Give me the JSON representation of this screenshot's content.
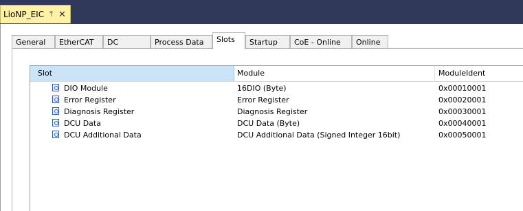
{
  "document_tab": {
    "title": "LioNP_EIC",
    "pin_icon": "pin-icon",
    "close_icon": "close-icon"
  },
  "tabs": [
    {
      "label": "General",
      "active": false
    },
    {
      "label": "EtherCAT",
      "active": false
    },
    {
      "label": "DC",
      "active": false
    },
    {
      "label": "Process Data",
      "active": false
    },
    {
      "label": "Slots",
      "active": true
    },
    {
      "label": "Startup",
      "active": false
    },
    {
      "label": "CoE - Online",
      "active": false
    },
    {
      "label": "Online",
      "active": false
    }
  ],
  "slots_table": {
    "columns": [
      "Slot",
      "Module",
      "ModuleIdent"
    ],
    "row_icon": "module-icon",
    "rows": [
      {
        "slot": "DIO Module",
        "module": "16DIO (Byte)",
        "ident": "0x00010001"
      },
      {
        "slot": "Error Register",
        "module": "Error Register",
        "ident": "0x00020001"
      },
      {
        "slot": "Diagnosis Register",
        "module": "Diagnosis Register",
        "ident": "0x00030001"
      },
      {
        "slot": "DCU Data",
        "module": "DCU Data (Byte)",
        "ident": "0x00040001"
      },
      {
        "slot": "DCU Additional Data",
        "module": "DCU Additional Data (Signed Integer 16bit)",
        "ident": "0x00050001"
      }
    ]
  },
  "colors": {
    "titlebar": "#2e3a58",
    "document_tab": "#fff1a6",
    "selected_header": "#cce4f7"
  }
}
